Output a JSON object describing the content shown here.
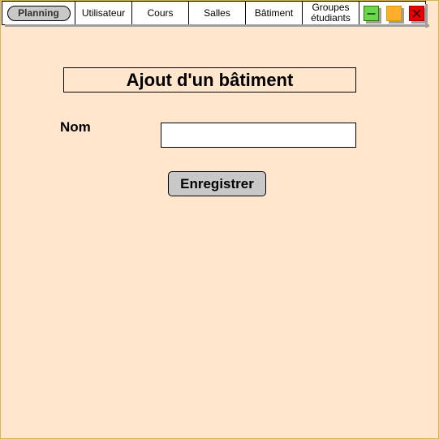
{
  "menu": {
    "items": [
      {
        "label": "Planning",
        "active": true
      },
      {
        "label": "Utilisateur"
      },
      {
        "label": "Cours"
      },
      {
        "label": "Salles"
      },
      {
        "label": "Bâtiment"
      },
      {
        "label": "Groupes étudiants",
        "line1": "Groupes",
        "line2": "étudiants"
      }
    ]
  },
  "window_controls": {
    "minimize": {
      "icon": "minimize-icon",
      "color": "#6cd650"
    },
    "maximize": {
      "icon": "maximize-icon",
      "color": "#ffae2c"
    },
    "close": {
      "icon": "close-icon",
      "color": "#e60000"
    }
  },
  "form": {
    "title": "Ajout d'un bâtiment",
    "name_label": "Nom",
    "name_value": "",
    "name_placeholder": "",
    "save_label": "Enregistrer"
  },
  "colors": {
    "background": "#ffe6cc",
    "border": "#d6b656",
    "button": "#c8c8c8"
  }
}
